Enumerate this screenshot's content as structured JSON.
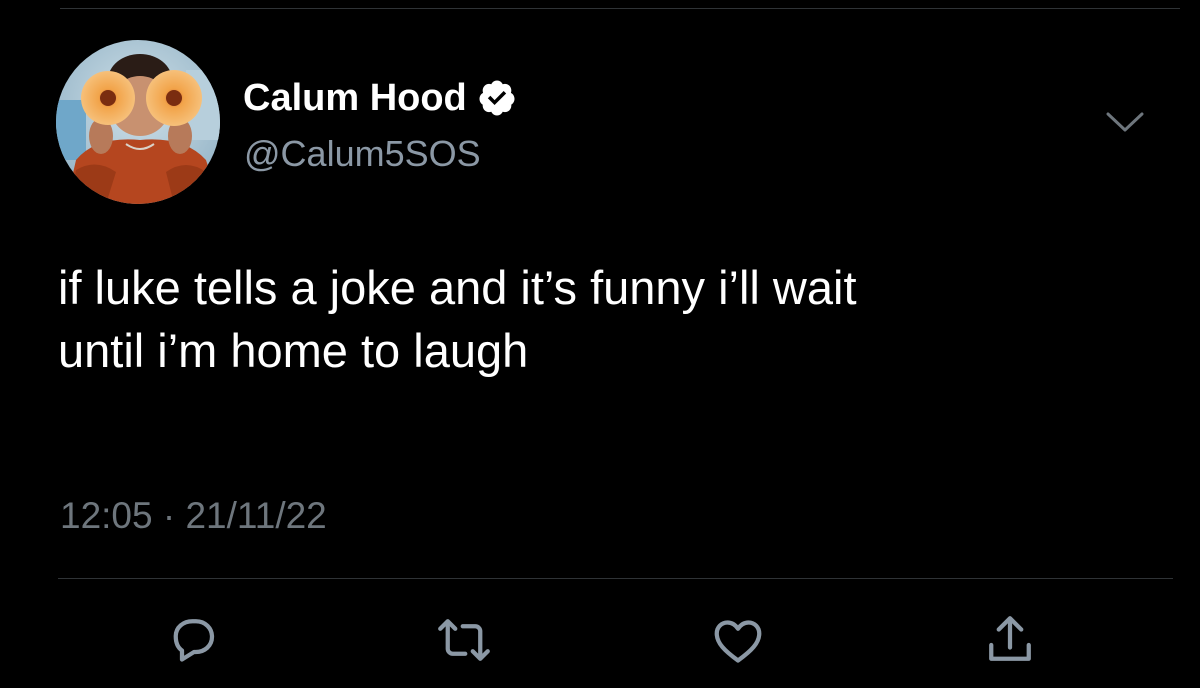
{
  "tweet": {
    "author": {
      "display_name": "Calum Hood",
      "handle": "@Calum5SOS",
      "verified": true,
      "avatar_icon": "profile-photo-with-flowers"
    },
    "text_lines": [
      "if luke tells a joke and it’s funny i’ll wait",
      "until i’m home to laugh"
    ],
    "time": "12:05",
    "separator": "·",
    "date": "21/11/22",
    "more_icon": "chevron-down-icon",
    "actions": [
      {
        "name": "reply",
        "icon": "reply-icon"
      },
      {
        "name": "retweet",
        "icon": "retweet-icon"
      },
      {
        "name": "like",
        "icon": "heart-icon"
      },
      {
        "name": "share",
        "icon": "share-icon"
      }
    ]
  },
  "colors": {
    "background": "#000000",
    "text_primary": "#ffffff",
    "text_secondary": "#8b98a5",
    "text_meta": "#6e767d",
    "divider": "#2f3336",
    "verified_badge": "#ffffff"
  }
}
